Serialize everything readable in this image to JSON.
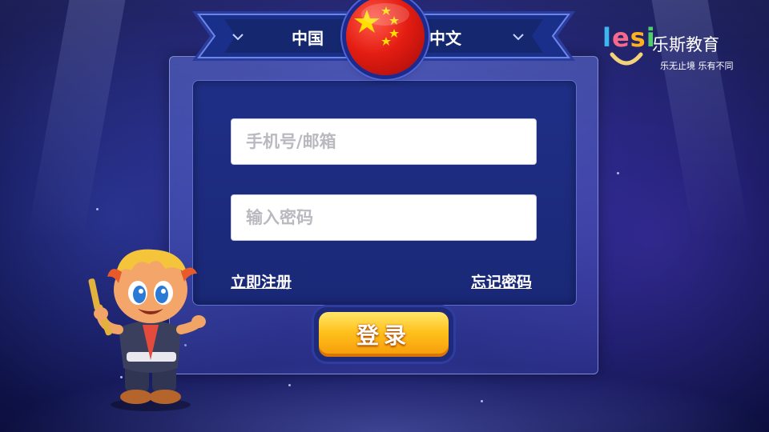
{
  "header": {
    "region_label": "中国",
    "language_label": "中文",
    "flag_icon": "china-flag-icon",
    "chevron_icon": "chevron-down-icon"
  },
  "form": {
    "phone_email_placeholder": "手机号/邮箱",
    "password_placeholder": "输入密码",
    "register_link": "立即注册",
    "forgot_link": "忘记密码",
    "login_button": "登录"
  },
  "logo": {
    "wordmark": "lesi",
    "name": "乐斯教育",
    "slogan": "乐无止境 乐有不同"
  },
  "colors": {
    "background": "#1b1e6e",
    "panel_inner": "#1f2f86",
    "login_button": "#ffc11c",
    "flag_red": "#e41d12",
    "flag_star": "#ffde00"
  }
}
